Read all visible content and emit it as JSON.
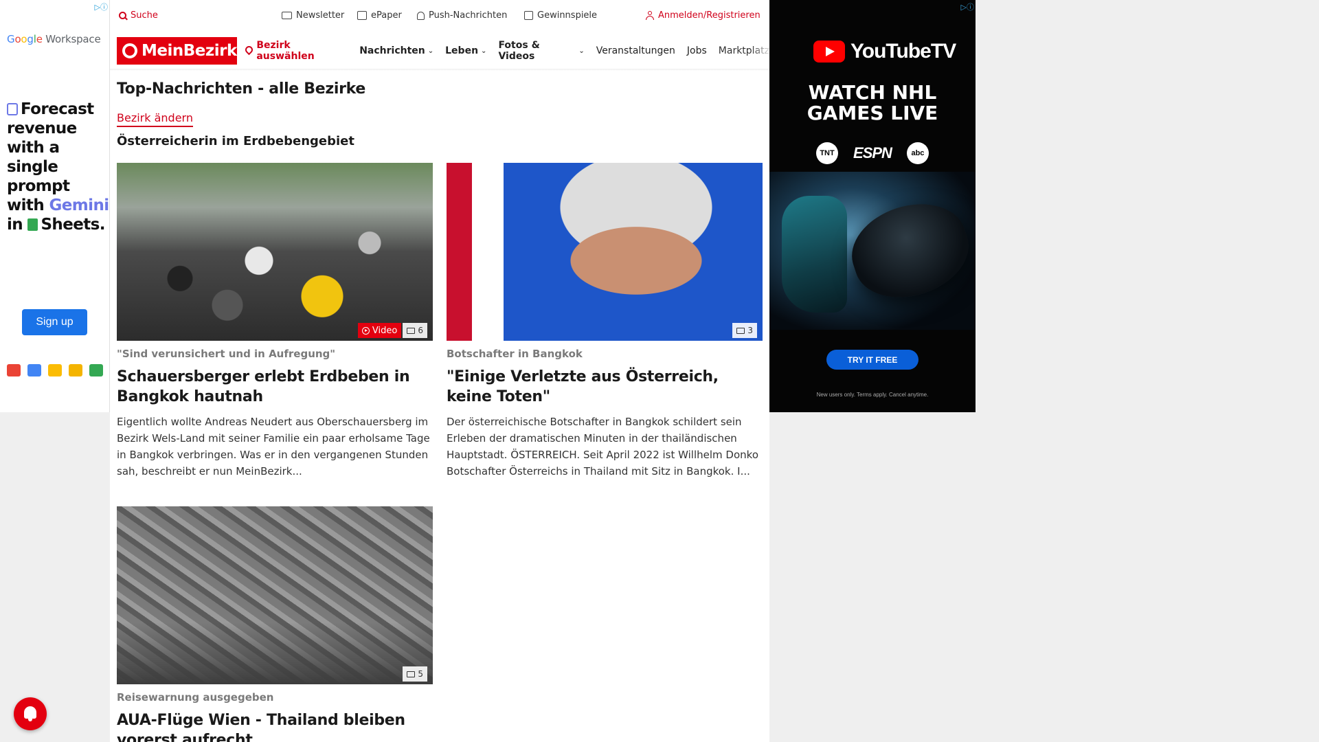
{
  "ads": {
    "left": {
      "brand": "Google Workspace",
      "headline_parts": [
        "Forecast revenue with a single prompt with ",
        "Gemini",
        " in ",
        "Sheets."
      ],
      "cta": "Sign up",
      "colors": {
        "cta": "#1a73e8",
        "accent": "#6d78e6"
      }
    },
    "right": {
      "brand": "YouTubeTV",
      "headline_line1": "WATCH NHL",
      "headline_line2": "GAMES LIVE",
      "networks": [
        "TNT",
        "ESPN",
        "abc"
      ],
      "cta": "TRY IT FREE",
      "fine_print": "New users only. Terms apply. Cancel anytime."
    }
  },
  "topbar": {
    "search": "Suche",
    "newsletter": "Newsletter",
    "epaper": "ePaper",
    "push": "Push-Nachrichten",
    "games": "Gewinnspiele",
    "login": "Anmelden/Registrieren"
  },
  "nav": {
    "logo": "MeinBezirk",
    "region": "Bezirk auswählen",
    "items": [
      "Nachrichten",
      "Leben",
      "Fotos & Videos",
      "Veranstaltungen",
      "Jobs",
      "Marktplatz"
    ],
    "brand_color": "#e3000f"
  },
  "page": {
    "title": "Top-Nachrichten - alle Bezirke",
    "change_link": "Bezirk ändern",
    "section": "Österreicherin im Erdbebengebiet"
  },
  "articles": [
    {
      "kicker": "\"Sind verunsichert und in Aufregung\"",
      "headline": "Schauersberger erlebt Erdbeben in Bangkok hautnah",
      "teaser": "Eigentlich wollte Andreas Neudert aus Oberschauersberg im Bezirk Wels-Land mit seiner Familie ein paar erholsame Tage in Bangkok verbringen. Was er in den vergangenen Stunden sah, beschreibt er nun MeinBezirk...",
      "video_label": "Video",
      "image_count": "6"
    },
    {
      "kicker": "Botschafter in Bangkok",
      "headline": "\"Einige Verletzte aus Österreich, keine Toten\"",
      "teaser": "Der österreichische Botschafter in Bangkok schildert sein Erleben der dramatischen Minuten in der thailändischen Hauptstadt. ÖSTERREICH. Seit April 2022 ist Willhelm Donko Botschafter Österreichs in Thailand mit Sitz in Bangkok. I...",
      "image_count": "3"
    },
    {
      "kicker": "Reisewarnung ausgegeben",
      "headline": "AUA-Flüge Wien - Thailand bleiben vorerst aufrecht",
      "image_count": "5"
    }
  ]
}
